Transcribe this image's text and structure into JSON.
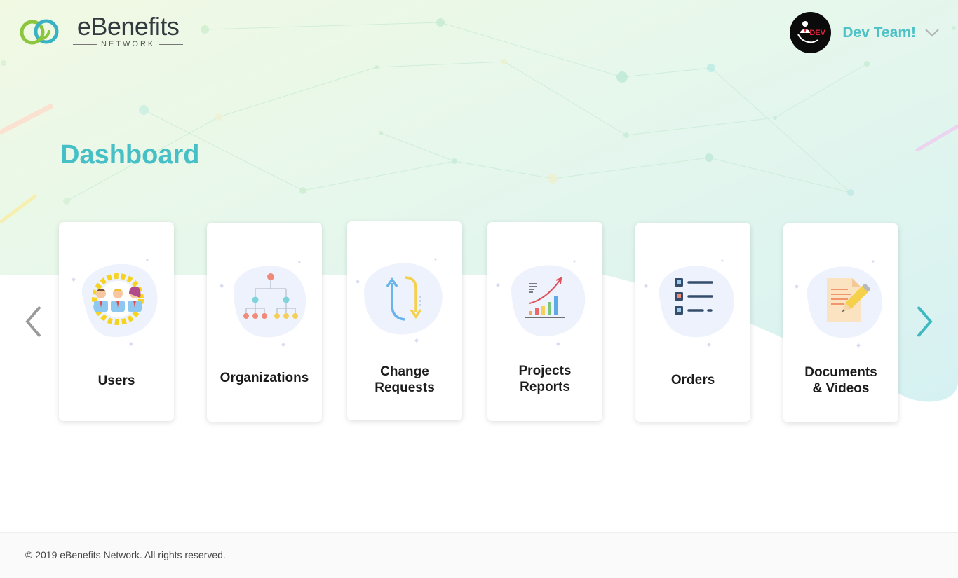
{
  "brand": {
    "name": "eBenefits",
    "tagline": "NETWORK"
  },
  "user": {
    "avatar_text": "DEV",
    "name": "Dev Team!"
  },
  "page": {
    "title": "Dashboard"
  },
  "cards": [
    {
      "label": "Users",
      "icon": "users-gear-icon"
    },
    {
      "label": "Organizations",
      "icon": "org-chart-icon"
    },
    {
      "label": "Change\nRequests",
      "icon": "change-arrows-icon"
    },
    {
      "label": "Projects\nReports",
      "icon": "growth-chart-icon"
    },
    {
      "label": "Orders",
      "icon": "checklist-icon"
    },
    {
      "label": "Documents\n& Videos",
      "icon": "document-pencil-icon"
    }
  ],
  "nav": {
    "prev_icon": "chevron-left-icon",
    "next_icon": "chevron-right-icon"
  },
  "footer": {
    "copyright": "© 2019 eBenefits Network. All rights reserved."
  },
  "colors": {
    "accent": "#47bfc6",
    "prev_arrow": "#9a9a9a",
    "next_arrow": "#3fb8c0",
    "avatar_badge": "#e0233a"
  }
}
